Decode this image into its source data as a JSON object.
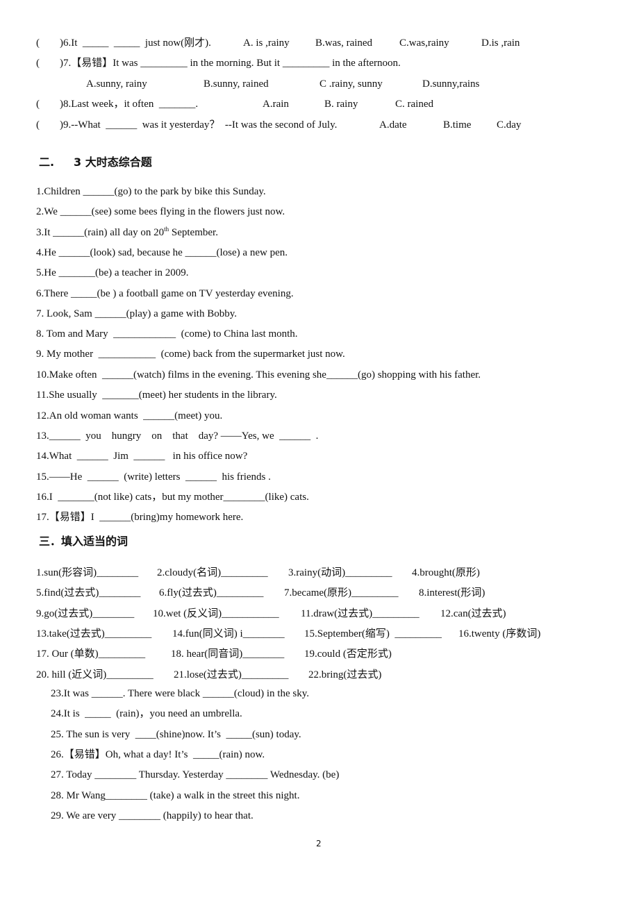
{
  "section1_mc": {
    "q6": {
      "paren": "(",
      "stem": ")6.It  _____  _____  just now(刚才).",
      "options": [
        "A. is ,rainy",
        "B.was, rained",
        "C.was,rainy",
        "D.is ,rain"
      ]
    },
    "q7": {
      "paren": "(",
      "stem": ")7.【易错】It was _________ in the morning. But it _________ in the afternoon.",
      "options": [
        "A.sunny, rainy",
        "B.sunny, rained",
        "C .rainy, sunny",
        "D.sunny,rains"
      ]
    },
    "q8": {
      "paren": "(",
      "stem": ")8.Last week，it often  _______.",
      "options": [
        "A.rain",
        "B. rainy",
        "C. rained"
      ]
    },
    "q9": {
      "paren": "(",
      "stem": ")9.--What  ______  was it yesterday？  --It was the second of July.",
      "options": [
        "A.date",
        "B.time",
        "C.day"
      ]
    }
  },
  "section2": {
    "heading_num": "二.",
    "heading_title": "3 大时态综合题",
    "items": [
      "1.Children ______(go) to the park by bike this Sunday.",
      "2.We ______(see) some bees flying in the flowers just now.",
      {
        "pre": "3.It ______(rain) all day on 20",
        "sup": "th",
        "post": " September."
      },
      "4.He ______(look) sad, because he ______(lose) a new pen.",
      "5.He _______(be) a teacher in 2009.",
      "6.There _____(be ) a football game on TV yesterday evening.",
      "7. Look, Sam ______(play) a game with Bobby.",
      "8. Tom and Mary  ____________  (come) to China last month.",
      "9. My mother  ___________  (come) back from the supermarket just now.",
      "10.Make often  ______(watch) films in the evening. This evening she______(go) shopping with his father.",
      "11.She usually  _______(meet) her students in the library.",
      "12.An old woman wants  ______(meet) you.",
      "13.______  you    hungry    on    that    day? ——Yes, we  ______  .",
      "14.What  ______  Jim  ______   in his office now?",
      "15.——He  ______  (write) letters  ______  his friends .",
      "16.I  _______(not like) cats，but my mother________(like) cats.",
      "17.【易错】I  ______(bring)my homework here."
    ]
  },
  "section3": {
    "heading": "三．填入适当的词",
    "grid": [
      [
        "1.sun(形容词)________",
        "2.cloudy(名词)_________",
        "3.rainy(动词)_________",
        "4.brought(原形)"
      ],
      [
        "5.find(过去式)________",
        "6.fly(过去式)_________",
        "7.became(原形)_________",
        "8.interest(形词)"
      ],
      [
        "9.go(过去式)________",
        "10.wet (反义词)___________",
        "11.draw(过去式)_________",
        "12.can(过去式)"
      ],
      [
        "13.take(过去式)_________",
        "14.fun(同义词) i________",
        "15.September(缩写)  _________",
        "16.twenty (序数词)"
      ],
      [
        "17. Our (单数)_________",
        "18. hear(同音词)________",
        "19.could (否定形式)",
        ""
      ],
      [
        "20. hill (近义词)_________",
        "21.lose(过去式)_________",
        "22.bring(过去式)",
        ""
      ]
    ],
    "sentences": [
      "23.It was ______. There were black ______(cloud) in the sky.",
      "24.It is  _____  (rain)，you need an umbrella.",
      "25. The sun is very  ____(shine)now. It’s  _____(sun) today.",
      "26.【易错】Oh, what a day! It’s  _____(rain) now.",
      "27. Today ________ Thursday. Yesterday ________ Wednesday. (be)",
      "28. Mr Wang________ (take) a walk in the street this night.",
      "29. We are very ________ (happily) to hear that."
    ]
  },
  "footer": {
    "page_number": "2"
  }
}
